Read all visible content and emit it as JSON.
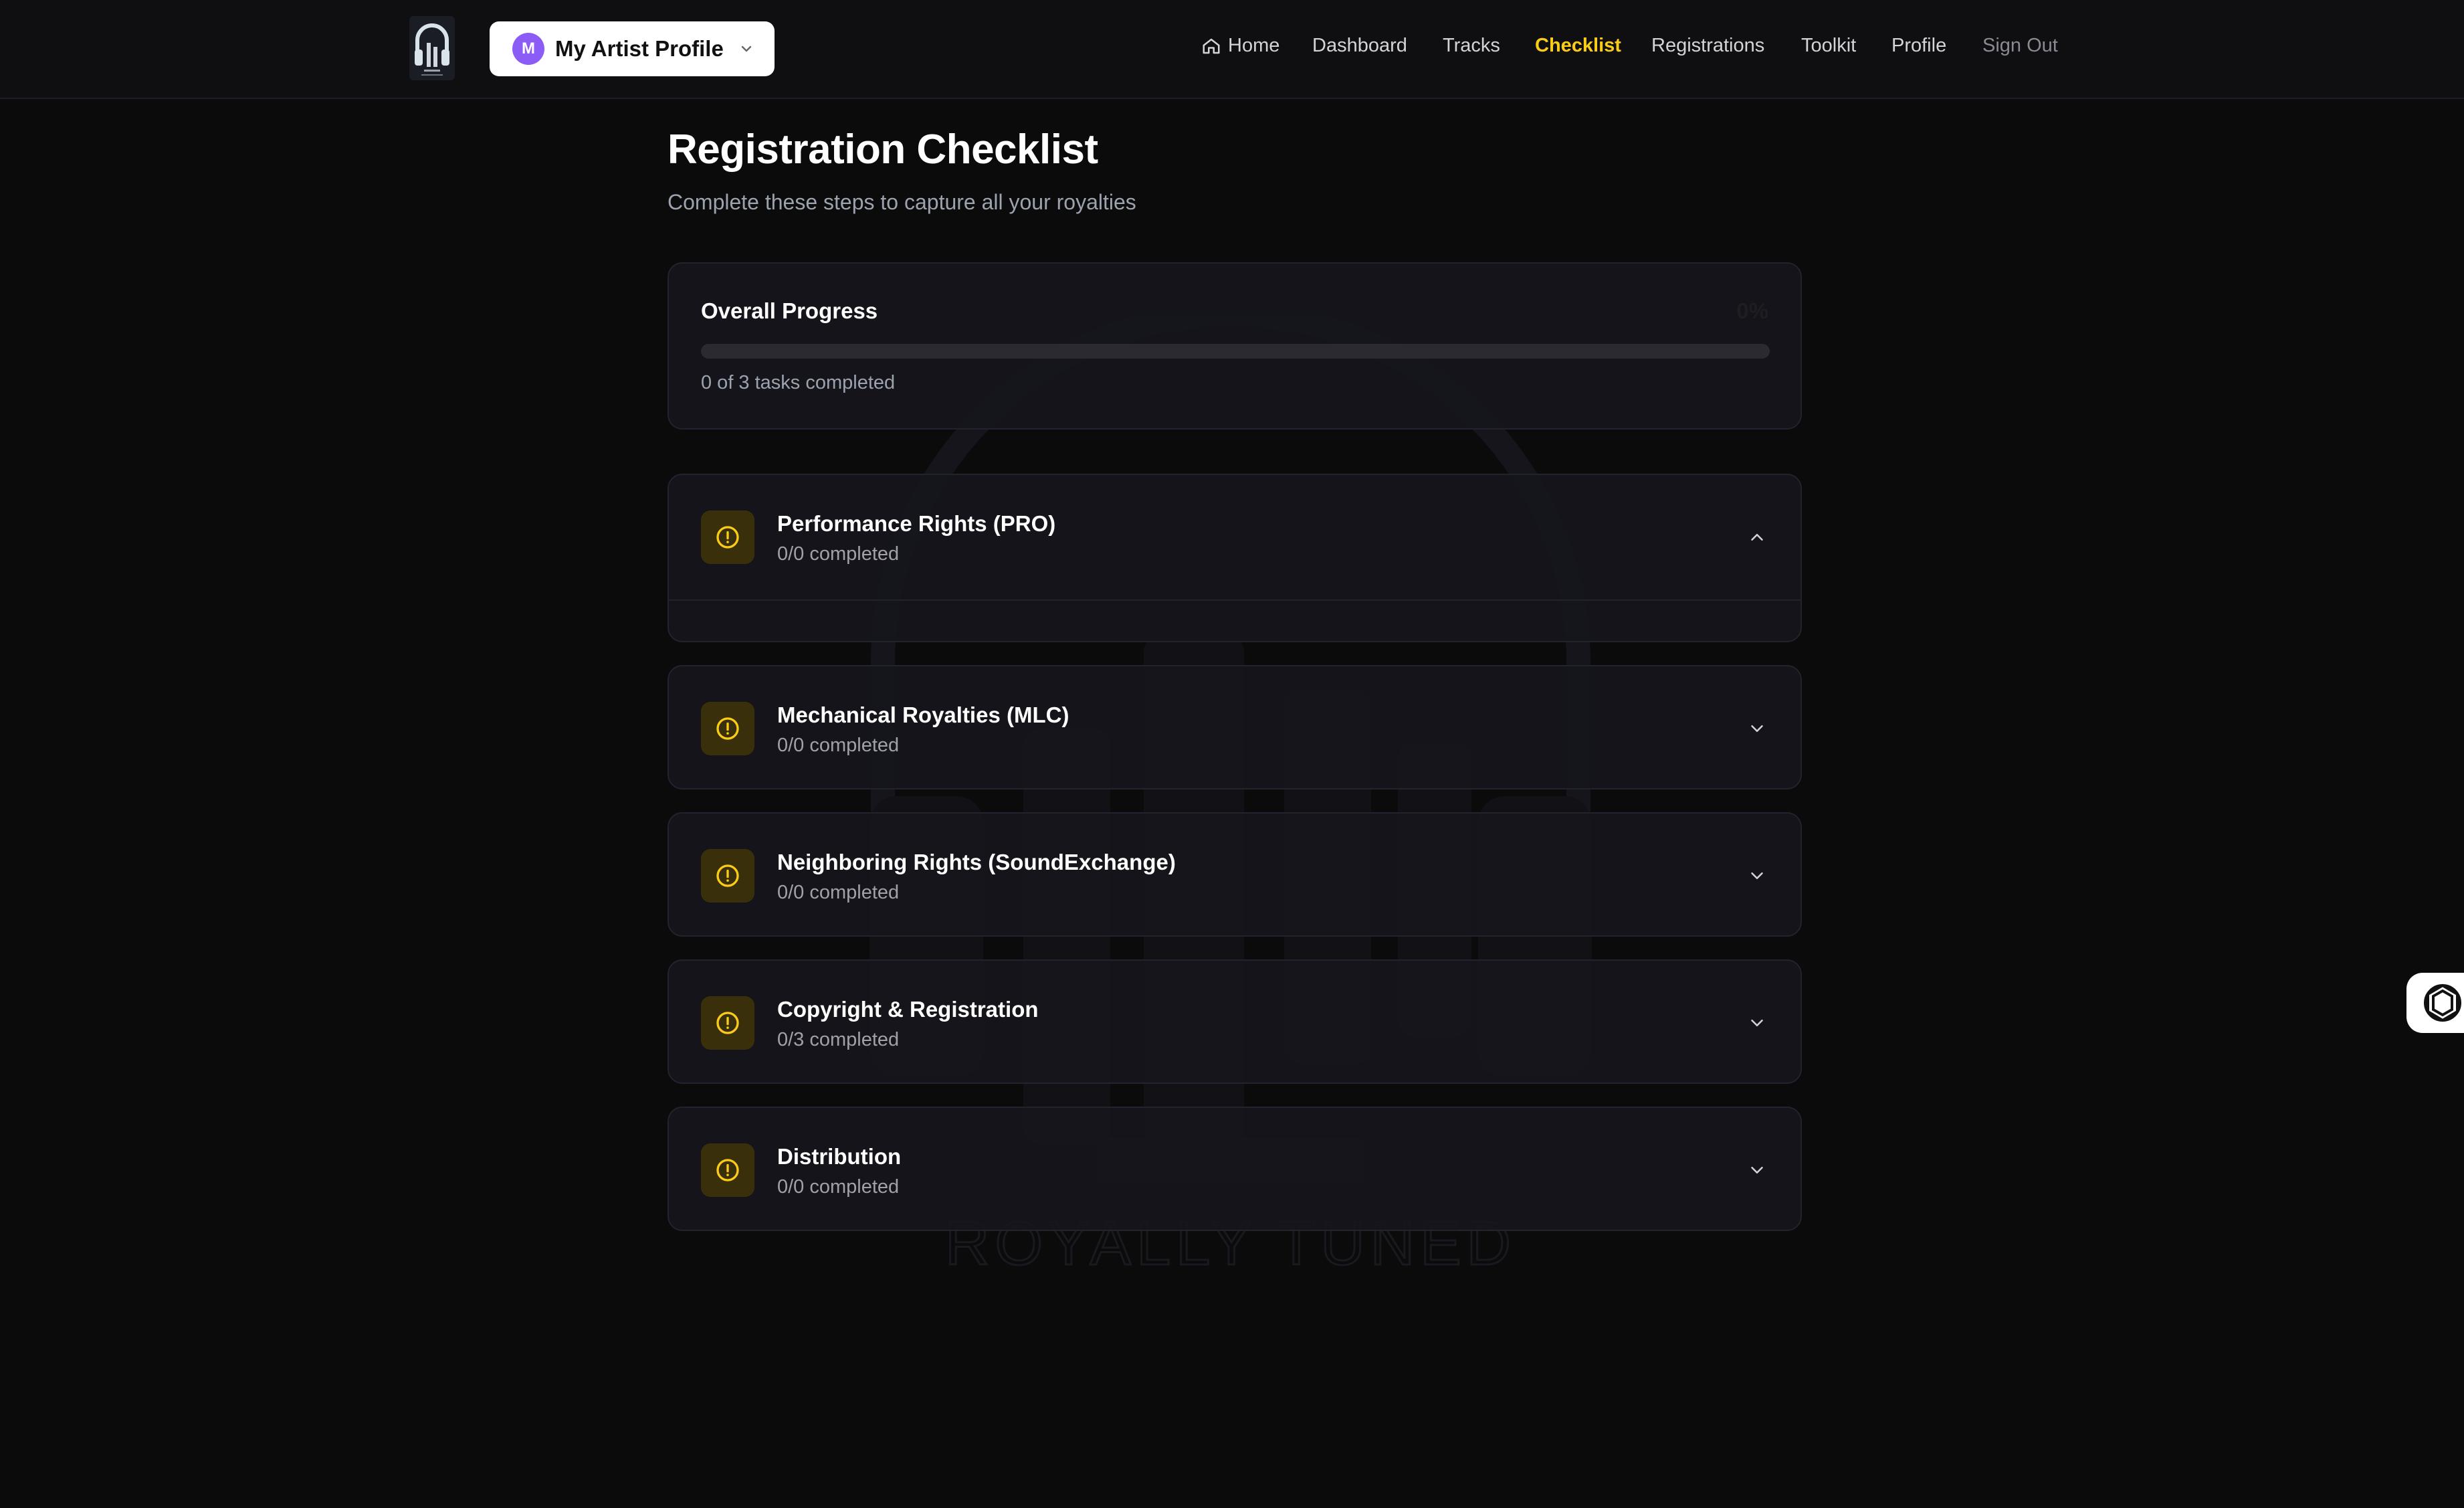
{
  "topbar": {
    "profile": {
      "avatar_initial": "M",
      "name": "My Artist Profile"
    },
    "nav": [
      {
        "label": "Home",
        "icon": "home-icon",
        "active": false
      },
      {
        "label": "Dashboard",
        "active": false
      },
      {
        "label": "Tracks",
        "active": false
      },
      {
        "label": "Checklist",
        "active": true
      },
      {
        "label": "Registrations",
        "active": false
      },
      {
        "label": "Toolkit",
        "active": false
      },
      {
        "label": "Profile",
        "active": false
      },
      {
        "label": "Sign Out",
        "active": false
      }
    ]
  },
  "header": {
    "title": "Registration Checklist",
    "subtitle": "Complete these steps to capture all your royalties"
  },
  "progress": {
    "label": "Overall Progress",
    "percent_text": "0%",
    "completed": 0,
    "total": 3,
    "fraction": 0,
    "count_text": "0 of 3 tasks completed"
  },
  "sections": [
    {
      "title": "Performance Rights (PRO)",
      "count": "0/0 completed",
      "expanded": true,
      "icon": "alert-circle-icon"
    },
    {
      "title": "Mechanical Royalties (MLC)",
      "count": "0/0 completed",
      "expanded": false,
      "icon": "alert-circle-icon"
    },
    {
      "title": "Neighboring Rights (SoundExchange)",
      "count": "0/0 completed",
      "expanded": false,
      "icon": "alert-circle-icon"
    },
    {
      "title": "Copyright & Registration",
      "count": "0/3 completed",
      "expanded": false,
      "icon": "alert-circle-icon"
    },
    {
      "title": "Distribution",
      "count": "0/0 completed",
      "expanded": false,
      "icon": "alert-circle-icon"
    }
  ],
  "watermark": {
    "brand_text": "ROYALLY TUNED"
  },
  "colors": {
    "accent": "#facc15",
    "background": "#0b0b0c",
    "card": "#16161c",
    "avatar": "#8b5cf6",
    "badge_bg": "#3a2f0b"
  }
}
